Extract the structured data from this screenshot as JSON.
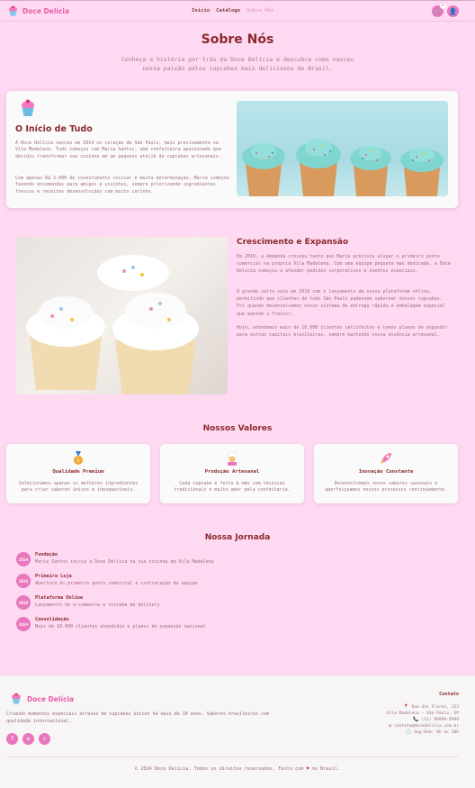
{
  "header": {
    "brand": "Doce Delícia",
    "nav": [
      {
        "label": "Início"
      },
      {
        "label": "Catálogo"
      },
      {
        "label": "Sobre Nós"
      }
    ],
    "cart_count": "0",
    "icons": [
      "cart-icon",
      "user-icon"
    ]
  },
  "hero": {
    "title": "Sobre Nós",
    "subtitle": "Conheça a história por trás da Doce Delícia e descubra como nasceu nossa paixão pelos cupcakes mais deliciosos do Brasil."
  },
  "story": {
    "title": "O Início de Tudo",
    "p1": "A Doce Delícia nasceu em 2014 no coração de São Paulo, mais precisamente na Vila Madalena. Tudo começou com Maria Santos, uma confeiteira apaixonada que decidiu transformar sua cozinha em um pequeno ateliê de cupcakes artesanais.",
    "p2": "Com apenas R$ 2.000 de investimento inicial e muita determinação, Maria começou fazendo encomendas para amigos e vizinhos, sempre priorizando ingredientes frescos e receitas desenvolvidas com muito carinho."
  },
  "growth": {
    "title": "Crescimento e Expansão",
    "p1": "Em 2016, a demanda cresceu tanto que Maria precisou alugar o primeiro ponto comercial na própria Vila Madalena. Com uma equipe pequena mas dedicada, a Doce Delícia começou a atender pedidos corporativos e eventos especiais.",
    "p2": "O grande salto veio em 2019 com o lançamento da nossa plataforma online, permitindo que clientes de todo São Paulo pudessem saborear nossos cupcakes. Foi quando desenvolvemos nosso sistema de entrega rápida e embalagem especial que mantém o frescor.",
    "p3": "Hoje, atendemos mais de 10.000 clientes satisfeitos e temos planos de expandir para outras capitais brasileiras, sempre mantendo nossa essência artesanal."
  },
  "values": {
    "title": "Nossos Valores",
    "items": [
      {
        "icon": "medal-icon",
        "title": "Qualidade Premium",
        "text": "Selecionamos apenas os melhores ingredientes para criar sabores únicos e inesquecíveis."
      },
      {
        "icon": "chef-icon",
        "title": "Produção Artesanal",
        "text": "Cada cupcake é feito à mão com técnicas tradicionais e muito amor pela confeitaria."
      },
      {
        "icon": "rocket-icon",
        "title": "Inovação Constante",
        "text": "Desenvolvemos novos sabores sazonais e aperfeiçoamos nossos processos continuamente."
      }
    ]
  },
  "journey": {
    "title": "Nossa Jornada",
    "items": [
      {
        "year": "2014",
        "title": "Fundação",
        "text": "Maria Santos inicia a Doce Delícia na sua cozinha em Vila Madalena"
      },
      {
        "year": "2016",
        "title": "Primeira Loja",
        "text": "Abertura do primeiro ponto comercial e contratação da equipe"
      },
      {
        "year": "2019",
        "title": "Plataforma Online",
        "text": "Lançamento do e-commerce e sistema de delivery"
      },
      {
        "year": "2024",
        "title": "Consolidação",
        "text": "Mais de 10.000 clientes atendidos e planos de expansão nacional"
      }
    ]
  },
  "footer": {
    "brand": "Doce Delícia",
    "description": "Criando momentos especiais através de cupcakes únicos há mais de 10 anos. Sabores brasileiros com qualidade internacional.",
    "contact_title": "Contato",
    "address_line1": "Rua das Flores, 123",
    "address_line2": "Vila Madalena - São Paulo, SP",
    "phone": "(11) 99999-9999",
    "email": "contato@docedelicia.com.br",
    "hours": "Seg-Dom: 8h às 20h",
    "copyright_pre": "© 2024 Doce Delícia. Todos os direitos reservados. Feito com",
    "copyright_post": "no Brasil."
  },
  "colors": {
    "accent": "#e878bd",
    "brand": "#e85ca7",
    "heading": "#8b2a2a",
    "background": "#fdd9f2"
  }
}
